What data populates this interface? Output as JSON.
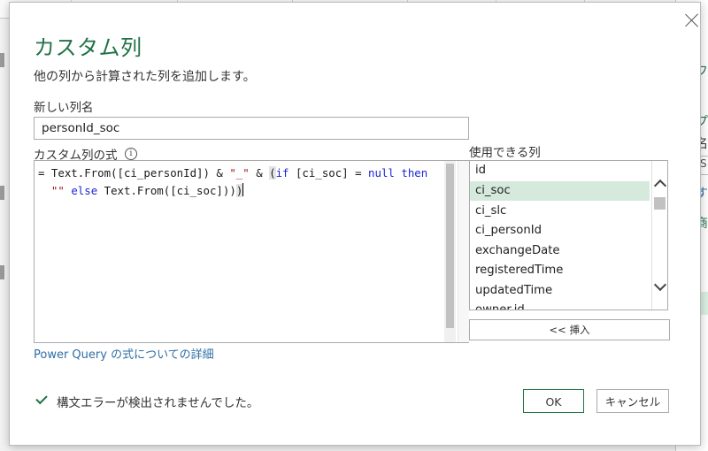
{
  "dialog": {
    "title": "カスタム列",
    "subtitle": "他の列から計算された列を追加します。",
    "new_column_label": "新しい列名",
    "new_column_value": "personId_soc",
    "formula_label": "カスタム列の式",
    "formula_info_icon": "i",
    "formula": {
      "line1_prefix": "= Text.From([ci_personId]) & ",
      "line1_str": "\"_\"",
      "line1_mid": " & ",
      "line1_paren": "(",
      "line1_kw_if": "if",
      "line1_cond": " [ci_soc] = ",
      "line1_kw_null": "null",
      "line1_kw_then": "then",
      "line2_str": "\"\"",
      "line2_kw_else": "else",
      "line2_rest": " Text.From([ci_soc]))",
      "line2_paren": ")"
    },
    "available_columns_label": "使用できる列",
    "available_columns": [
      "id",
      "ci_soc",
      "ci_slc",
      "ci_personId",
      "exchangeDate",
      "registeredTime",
      "updatedTime",
      "owner.id"
    ],
    "selected_column": "ci_soc",
    "insert_button": "<< 挿入",
    "learn_more_link": "Power Query の式についての詳細",
    "status_text": "構文エラーが検出されませんでした。",
    "ok_button": "OK",
    "cancel_button": "キャンセル",
    "close_icon": "close-icon",
    "colors": {
      "accent": "#217346",
      "keyword": "#1a27d6",
      "string": "#a31515",
      "link": "#2e6ea6",
      "selection": "#d5eadd"
    }
  },
  "background": {
    "right_panel_glyphs": [
      "フ",
      "プ",
      "名",
      "S",
      "す",
      "商"
    ]
  }
}
